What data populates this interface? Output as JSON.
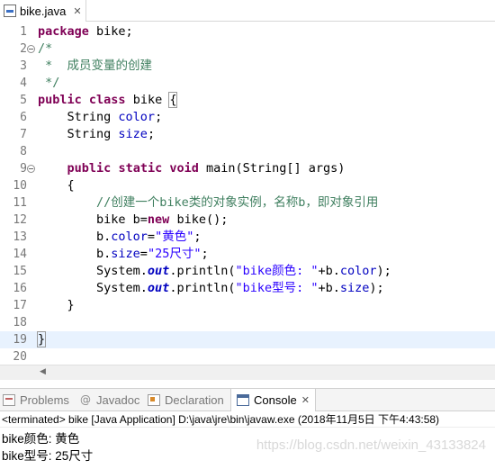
{
  "editor": {
    "tab_label": "bike.java",
    "tab_close": "✕"
  },
  "code": {
    "line_numbers": [
      "1",
      "2",
      "3",
      "4",
      "5",
      "6",
      "7",
      "8",
      "9",
      "10",
      "11",
      "12",
      "13",
      "14",
      "15",
      "16",
      "17",
      "18",
      "19",
      "20"
    ],
    "l1_kw": "package",
    "l1_rest": " bike;",
    "l2": "/*",
    "l3": " *  成员变量的创建",
    "l4": " */",
    "l5_kw1": "public",
    "l5_sp": " ",
    "l5_kw2": "class",
    "l5_rest": " bike ",
    "l5_brace": "{",
    "l6_indent": "    ",
    "l6_type": "String ",
    "l6_field": "color",
    "l6_end": ";",
    "l7_indent": "    ",
    "l7_type": "String ",
    "l7_field": "size",
    "l7_end": ";",
    "l9_indent": "    ",
    "l9_kw1": "public",
    "l9_kw2": "static",
    "l9_kw3": "void",
    "l9_rest": " main(String[] args)",
    "l10": "    {",
    "l11_indent": "        ",
    "l11_comment": "//创建一个bike类的对象实例，名称b，即对象引用",
    "l12_a": "        bike b=",
    "l12_kw": "new",
    "l12_b": " bike();",
    "l13_a": "        b.",
    "l13_field": "color",
    "l13_b": "=",
    "l13_str": "\"黄色\"",
    "l13_c": ";",
    "l14_a": "        b.",
    "l14_field": "size",
    "l14_b": "=",
    "l14_str": "\"25尺寸\"",
    "l14_c": ";",
    "l15_a": "        System.",
    "l15_out": "out",
    "l15_b": ".println(",
    "l15_str": "\"bike颜色: \"",
    "l15_c": "+b.",
    "l15_field": "color",
    "l15_d": ");",
    "l16_a": "        System.",
    "l16_out": "out",
    "l16_b": ".println(",
    "l16_str": "\"bike型号: \"",
    "l16_c": "+b.",
    "l16_field": "size",
    "l16_d": ");",
    "l17": "    }",
    "l19": "}"
  },
  "views": {
    "tabs": [
      {
        "label": "Problems",
        "icon": "problems-icon"
      },
      {
        "label": "Javadoc",
        "icon": "javadoc-icon"
      },
      {
        "label": "Declaration",
        "icon": "declaration-icon"
      },
      {
        "label": "Console",
        "icon": "console-icon"
      }
    ],
    "javadoc_glyph": "@",
    "close": "✕"
  },
  "console": {
    "status": "<terminated> bike [Java Application] D:\\java\\jre\\bin\\javaw.exe (2018年11月5日 下午4:43:58)",
    "output": [
      "bike颜色: 黄色",
      "bike型号: 25尺寸"
    ],
    "watermark": "https://blog.csdn.net/weixin_43133824"
  },
  "colors": {
    "keyword": "#7f0055",
    "field": "#0000c0",
    "string": "#2a00ff",
    "comment": "#3f7f5f",
    "current_line": "#e8f2fe"
  }
}
